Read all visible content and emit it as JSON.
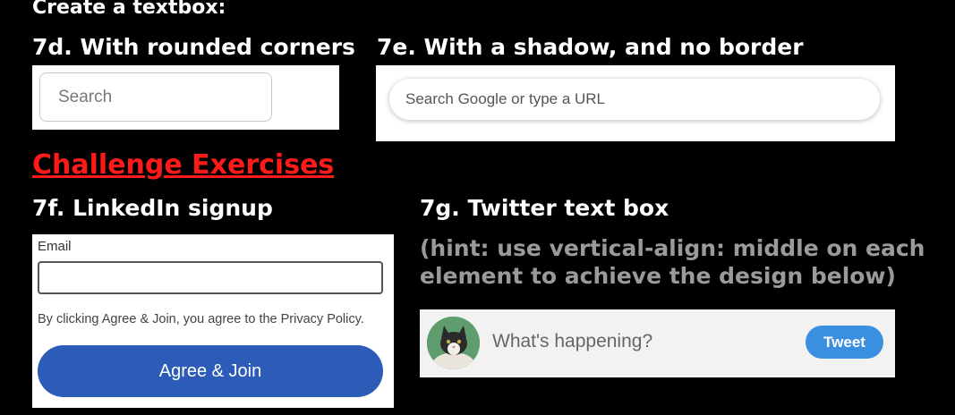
{
  "headings": {
    "top": "Create a textbox:",
    "rounded": "7d. With rounded corners",
    "shadow": "7e. With a shadow, and no border",
    "challenge": "Challenge Exercises",
    "linkedin": "7f. LinkedIn signup",
    "twitter": "7g. Twitter text box"
  },
  "hint": {
    "line1": "(hint: use vertical-align: middle on each",
    "line2": "element to achieve the design below)"
  },
  "rounded_box": {
    "placeholder": "Search"
  },
  "shadow_box": {
    "placeholder": "Search Google or type a URL"
  },
  "linkedin": {
    "email_label": "Email",
    "email_value": "",
    "policy_text": "By clicking Agree & Join, you agree to the Privacy Policy.",
    "button_label": "Agree & Join"
  },
  "twitter": {
    "placeholder": "What's happening?",
    "button_label": "Tweet",
    "avatar_icon": "cat-avatar-icon"
  },
  "colors": {
    "challenge_red": "#ff1a1a",
    "linkedin_blue": "#2c5cb8",
    "tweet_blue": "#3b8fe0",
    "hint_gray": "#9a9a9a"
  }
}
